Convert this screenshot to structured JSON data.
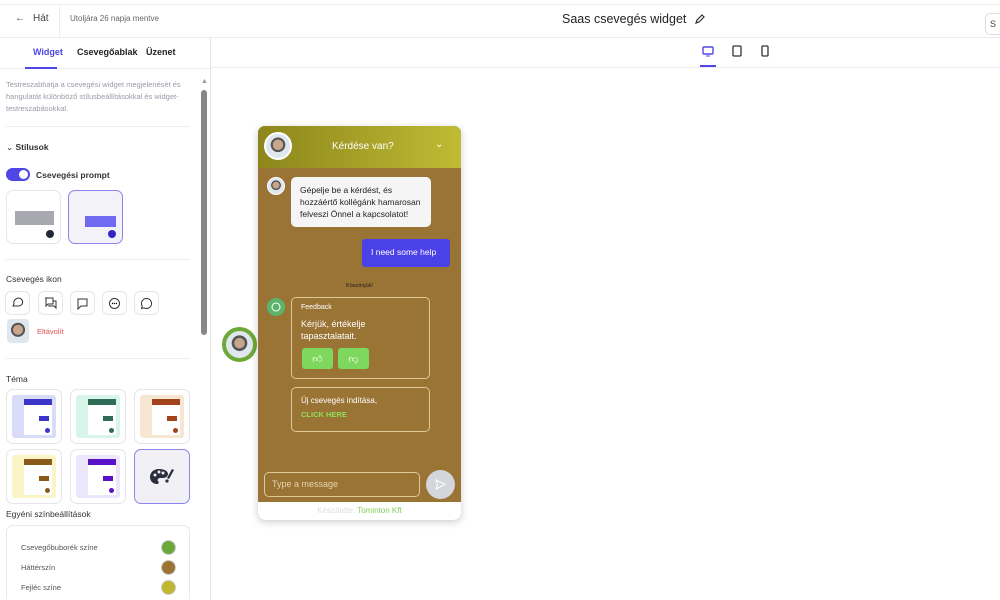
{
  "topbar": {
    "back_label": "Hát",
    "saved_status": "Utoljára 26 napja mentve",
    "title": "Saas csevegés widget",
    "save_label": "S"
  },
  "sidebar": {
    "tabs": [
      "Widget",
      "Csevegőablak",
      "Üzenet"
    ],
    "description": "Testreszabhatja a csevegési widget megjelenését és hangulatát különböző stílusbeállításokkal és widget-testreszabásokkal.",
    "styles_heading": "Stílusok",
    "prompt_toggle_label": "Csevegési prompt",
    "prompt_toggle_on": true,
    "chat_icon_heading": "Csevegés ikon",
    "chat_icons": [
      "chat-bubbles-icon",
      "message-square-icon",
      "chat-bubble-icon",
      "chat-dots-icon",
      "whatsapp-icon"
    ],
    "remove_label": "Eltávolít",
    "theme_heading": "Téma",
    "themes": [
      {
        "bg": "#d9dcf8",
        "accent": "#3b35c9"
      },
      {
        "bg": "#d8f5ea",
        "accent": "#2f6b55"
      },
      {
        "bg": "#f6e6d2",
        "accent": "#a2431c"
      },
      {
        "bg": "#faf4c6",
        "accent": "#8a5a1c"
      },
      {
        "bg": "#ebe6fb",
        "accent": "#5a12c8"
      }
    ],
    "custom_colors_heading": "Egyéni színbeállítások",
    "colors": [
      {
        "label": "Csevegőbuborék színe",
        "value": "#6aa83a"
      },
      {
        "label": "Háttérszín",
        "value": "#9b7433"
      },
      {
        "label": "Fejléc színe",
        "value": "#bdb82e"
      }
    ]
  },
  "preview": {
    "header_title": "Kérdése van?",
    "bot_message": "Gépelje be a kérdést, és hozzáértő kollégánk hamarosan felveszi Önnel a kapcsolatot!",
    "user_message": "I need some help",
    "thanks": "Köszönjük!",
    "feedback_title": "Feedback",
    "feedback_text": "Kérjük, értékelje tapasztalatait.",
    "new_chat_text": "Új csevegés indítása,",
    "new_chat_link": "CLICK HERE",
    "input_placeholder": "Type a message",
    "footer_prefix": "Készítette:",
    "footer_brand": "Tominton Kft"
  }
}
